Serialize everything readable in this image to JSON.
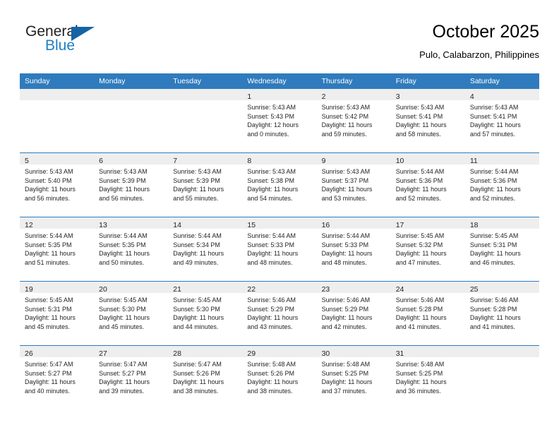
{
  "brand": {
    "name_top": "General",
    "name_bottom": "Blue",
    "color_dark": "#231f20",
    "color_blue": "#1f7fc4",
    "triangle_color": "#1464a5"
  },
  "header": {
    "title": "October 2025",
    "subtitle": "Pulo, Calabarzon, Philippines"
  },
  "theme": {
    "header_row_bg": "#2f7bbd",
    "header_row_text": "#ffffff",
    "daynum_strip_bg": "#eeeeee",
    "cell_bg": "#ffffff",
    "divider": "#2f7bbd"
  },
  "weekday_headers": [
    "Sunday",
    "Monday",
    "Tuesday",
    "Wednesday",
    "Thursday",
    "Friday",
    "Saturday"
  ],
  "weeks": [
    [
      {
        "day": "",
        "lines": []
      },
      {
        "day": "",
        "lines": []
      },
      {
        "day": "",
        "lines": []
      },
      {
        "day": "1",
        "lines": [
          "Sunrise: 5:43 AM",
          "Sunset: 5:43 PM",
          "Daylight: 12 hours",
          "and 0 minutes."
        ]
      },
      {
        "day": "2",
        "lines": [
          "Sunrise: 5:43 AM",
          "Sunset: 5:42 PM",
          "Daylight: 11 hours",
          "and 59 minutes."
        ]
      },
      {
        "day": "3",
        "lines": [
          "Sunrise: 5:43 AM",
          "Sunset: 5:41 PM",
          "Daylight: 11 hours",
          "and 58 minutes."
        ]
      },
      {
        "day": "4",
        "lines": [
          "Sunrise: 5:43 AM",
          "Sunset: 5:41 PM",
          "Daylight: 11 hours",
          "and 57 minutes."
        ]
      }
    ],
    [
      {
        "day": "5",
        "lines": [
          "Sunrise: 5:43 AM",
          "Sunset: 5:40 PM",
          "Daylight: 11 hours",
          "and 56 minutes."
        ]
      },
      {
        "day": "6",
        "lines": [
          "Sunrise: 5:43 AM",
          "Sunset: 5:39 PM",
          "Daylight: 11 hours",
          "and 56 minutes."
        ]
      },
      {
        "day": "7",
        "lines": [
          "Sunrise: 5:43 AM",
          "Sunset: 5:39 PM",
          "Daylight: 11 hours",
          "and 55 minutes."
        ]
      },
      {
        "day": "8",
        "lines": [
          "Sunrise: 5:43 AM",
          "Sunset: 5:38 PM",
          "Daylight: 11 hours",
          "and 54 minutes."
        ]
      },
      {
        "day": "9",
        "lines": [
          "Sunrise: 5:43 AM",
          "Sunset: 5:37 PM",
          "Daylight: 11 hours",
          "and 53 minutes."
        ]
      },
      {
        "day": "10",
        "lines": [
          "Sunrise: 5:44 AM",
          "Sunset: 5:36 PM",
          "Daylight: 11 hours",
          "and 52 minutes."
        ]
      },
      {
        "day": "11",
        "lines": [
          "Sunrise: 5:44 AM",
          "Sunset: 5:36 PM",
          "Daylight: 11 hours",
          "and 52 minutes."
        ]
      }
    ],
    [
      {
        "day": "12",
        "lines": [
          "Sunrise: 5:44 AM",
          "Sunset: 5:35 PM",
          "Daylight: 11 hours",
          "and 51 minutes."
        ]
      },
      {
        "day": "13",
        "lines": [
          "Sunrise: 5:44 AM",
          "Sunset: 5:35 PM",
          "Daylight: 11 hours",
          "and 50 minutes."
        ]
      },
      {
        "day": "14",
        "lines": [
          "Sunrise: 5:44 AM",
          "Sunset: 5:34 PM",
          "Daylight: 11 hours",
          "and 49 minutes."
        ]
      },
      {
        "day": "15",
        "lines": [
          "Sunrise: 5:44 AM",
          "Sunset: 5:33 PM",
          "Daylight: 11 hours",
          "and 48 minutes."
        ]
      },
      {
        "day": "16",
        "lines": [
          "Sunrise: 5:44 AM",
          "Sunset: 5:33 PM",
          "Daylight: 11 hours",
          "and 48 minutes."
        ]
      },
      {
        "day": "17",
        "lines": [
          "Sunrise: 5:45 AM",
          "Sunset: 5:32 PM",
          "Daylight: 11 hours",
          "and 47 minutes."
        ]
      },
      {
        "day": "18",
        "lines": [
          "Sunrise: 5:45 AM",
          "Sunset: 5:31 PM",
          "Daylight: 11 hours",
          "and 46 minutes."
        ]
      }
    ],
    [
      {
        "day": "19",
        "lines": [
          "Sunrise: 5:45 AM",
          "Sunset: 5:31 PM",
          "Daylight: 11 hours",
          "and 45 minutes."
        ]
      },
      {
        "day": "20",
        "lines": [
          "Sunrise: 5:45 AM",
          "Sunset: 5:30 PM",
          "Daylight: 11 hours",
          "and 45 minutes."
        ]
      },
      {
        "day": "21",
        "lines": [
          "Sunrise: 5:45 AM",
          "Sunset: 5:30 PM",
          "Daylight: 11 hours",
          "and 44 minutes."
        ]
      },
      {
        "day": "22",
        "lines": [
          "Sunrise: 5:46 AM",
          "Sunset: 5:29 PM",
          "Daylight: 11 hours",
          "and 43 minutes."
        ]
      },
      {
        "day": "23",
        "lines": [
          "Sunrise: 5:46 AM",
          "Sunset: 5:29 PM",
          "Daylight: 11 hours",
          "and 42 minutes."
        ]
      },
      {
        "day": "24",
        "lines": [
          "Sunrise: 5:46 AM",
          "Sunset: 5:28 PM",
          "Daylight: 11 hours",
          "and 41 minutes."
        ]
      },
      {
        "day": "25",
        "lines": [
          "Sunrise: 5:46 AM",
          "Sunset: 5:28 PM",
          "Daylight: 11 hours",
          "and 41 minutes."
        ]
      }
    ],
    [
      {
        "day": "26",
        "lines": [
          "Sunrise: 5:47 AM",
          "Sunset: 5:27 PM",
          "Daylight: 11 hours",
          "and 40 minutes."
        ]
      },
      {
        "day": "27",
        "lines": [
          "Sunrise: 5:47 AM",
          "Sunset: 5:27 PM",
          "Daylight: 11 hours",
          "and 39 minutes."
        ]
      },
      {
        "day": "28",
        "lines": [
          "Sunrise: 5:47 AM",
          "Sunset: 5:26 PM",
          "Daylight: 11 hours",
          "and 38 minutes."
        ]
      },
      {
        "day": "29",
        "lines": [
          "Sunrise: 5:48 AM",
          "Sunset: 5:26 PM",
          "Daylight: 11 hours",
          "and 38 minutes."
        ]
      },
      {
        "day": "30",
        "lines": [
          "Sunrise: 5:48 AM",
          "Sunset: 5:25 PM",
          "Daylight: 11 hours",
          "and 37 minutes."
        ]
      },
      {
        "day": "31",
        "lines": [
          "Sunrise: 5:48 AM",
          "Sunset: 5:25 PM",
          "Daylight: 11 hours",
          "and 36 minutes."
        ]
      },
      {
        "day": "",
        "lines": []
      }
    ]
  ]
}
